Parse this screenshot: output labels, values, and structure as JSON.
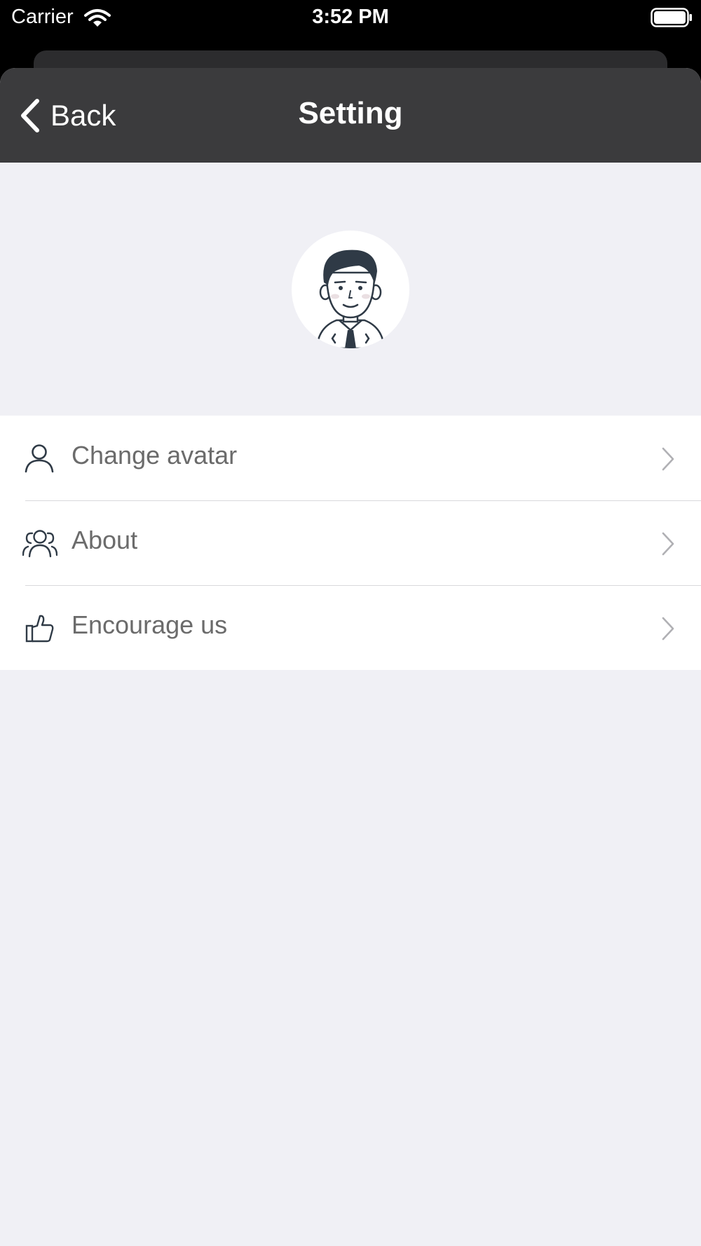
{
  "status_bar": {
    "carrier": "Carrier",
    "time": "3:52 PM"
  },
  "nav": {
    "back_label": "Back",
    "title": "Setting"
  },
  "menu": {
    "items": [
      {
        "label": "Change avatar",
        "icon": "person-icon"
      },
      {
        "label": "About",
        "icon": "group-icon"
      },
      {
        "label": "Encourage us",
        "icon": "thumbs-up-icon"
      }
    ]
  },
  "colors": {
    "nav_background": "#3b3b3d",
    "page_background": "#f0f0f5",
    "label_text": "#6b6b6b"
  }
}
